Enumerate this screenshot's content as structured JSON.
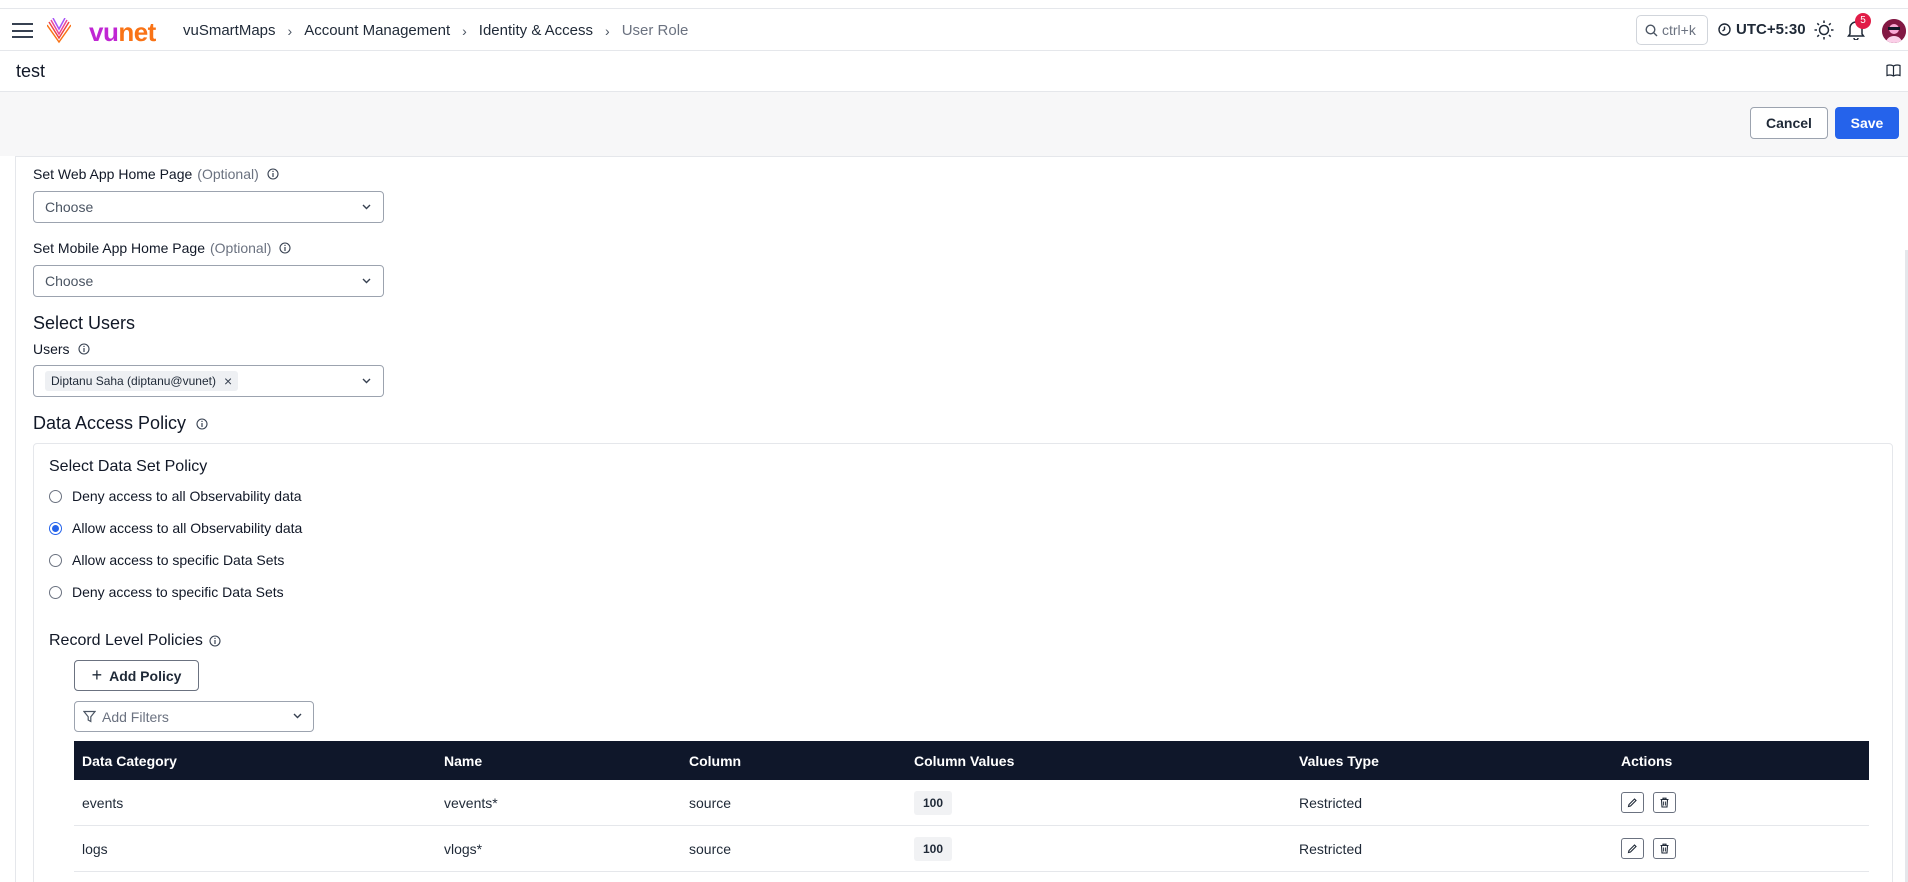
{
  "header": {
    "logo_text_a": "vu",
    "logo_text_b": "net",
    "breadcrumb": [
      "vuSmartMaps",
      "Account Management",
      "Identity & Access",
      "User Role"
    ],
    "search_shortcut": "ctrl+k",
    "timezone": "UTC+5:30",
    "notification_count": "5",
    "icons": [
      "menu-icon",
      "search-icon",
      "clock-icon",
      "sun-icon",
      "bell-icon",
      "avatar"
    ]
  },
  "page": {
    "title": "test",
    "cancel_label": "Cancel",
    "save_label": "Save"
  },
  "form": {
    "web_home": {
      "label": "Set Web App Home Page",
      "optional": "(Optional)",
      "placeholder": "Choose"
    },
    "mobile_home": {
      "label": "Set Mobile App Home Page",
      "optional": "(Optional)",
      "placeholder": "Choose"
    },
    "select_users": {
      "heading": "Select Users",
      "label": "Users",
      "chips": [
        "Diptanu Saha (diptanu@vunet)"
      ]
    },
    "data_access": {
      "heading": "Data Access Policy",
      "dataset_policy_heading": "Select Data Set Policy",
      "options": [
        {
          "label": "Deny access to all Observability data",
          "selected": false
        },
        {
          "label": "Allow access to all Observability data",
          "selected": true
        },
        {
          "label": "Allow access to specific Data Sets",
          "selected": false
        },
        {
          "label": "Deny access to specific Data Sets",
          "selected": false
        }
      ],
      "record_policies_heading": "Record Level Policies",
      "add_policy_label": "Add Policy",
      "filter_placeholder": "Add Filters",
      "table": {
        "columns": [
          "Data Category",
          "Name",
          "Column",
          "Column Values",
          "Values Type",
          "Actions"
        ],
        "rows": [
          {
            "category": "events",
            "name": "vevents*",
            "column": "source",
            "values": "100",
            "values_type": "Restricted"
          },
          {
            "category": "logs",
            "name": "vlogs*",
            "column": "source",
            "values": "100",
            "values_type": "Restricted"
          }
        ]
      }
    }
  },
  "colors": {
    "primary": "#2563eb",
    "table_header": "#0f172a",
    "brand_a": "#c026d3",
    "brand_b": "#f97316",
    "badge": "#e11d48"
  }
}
